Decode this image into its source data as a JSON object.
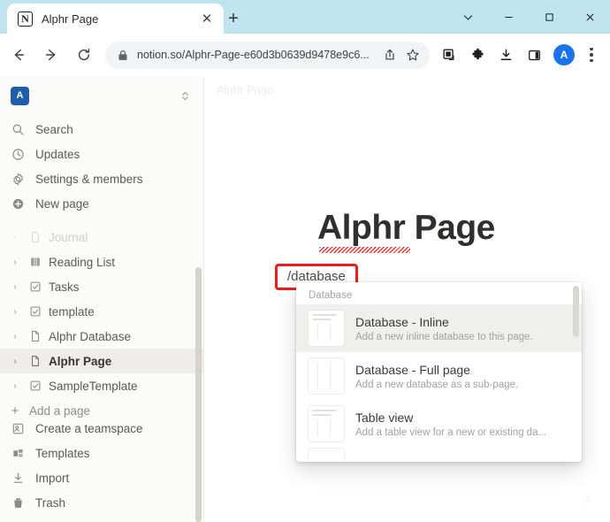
{
  "window": {
    "controls": [
      {
        "name": "tab-search-button",
        "icon": "chevron-down-icon"
      },
      {
        "name": "minimize-button",
        "icon": "minimize-icon"
      },
      {
        "name": "maximize-button",
        "icon": "maximize-icon"
      },
      {
        "name": "close-button",
        "icon": "close-icon"
      }
    ]
  },
  "tab": {
    "title": "Alphr Page",
    "favicon_letter": "N",
    "close_glyph": "✕",
    "new_tab_glyph": "+"
  },
  "toolbar": {
    "back_title": "Back",
    "forward_title": "Forward",
    "reload_title": "Reload",
    "url": "notion.so/Alphr-Page-e60d3b0639d9478e9c6...",
    "lock_icon": "lock-icon",
    "share_icon": "share-icon",
    "bookmark_icon": "star-icon",
    "capture_icon": "screen-capture-icon",
    "extensions_icon": "puzzle-icon",
    "downloads_icon": "download-icon",
    "side_panel_icon": "side-panel-icon",
    "avatar_letter": "A",
    "menu_icon": "three-dot-menu-icon"
  },
  "sidebar": {
    "workspace": {
      "badge_letter": "A",
      "switcher_icon": "chevron-up-down-icon"
    },
    "nav": [
      {
        "label": "Search",
        "icon": "search-icon"
      },
      {
        "label": "Updates",
        "icon": "clock-icon"
      },
      {
        "label": "Settings & members",
        "icon": "gear-icon"
      },
      {
        "label": "New page",
        "icon": "plus-circle-icon"
      }
    ],
    "pages_cut_off": {
      "label": "Journal",
      "icon": "page-icon"
    },
    "pages": [
      {
        "label": "Reading List",
        "icon": "books-icon",
        "caret": "›",
        "active": false
      },
      {
        "label": "Tasks",
        "icon": "checkbox-icon",
        "caret": "›",
        "active": false
      },
      {
        "label": "template",
        "icon": "checkbox-icon",
        "caret": "›",
        "active": false
      },
      {
        "label": "Alphr Database",
        "icon": "page-icon",
        "caret": "›",
        "active": false
      },
      {
        "label": "Alphr Page",
        "icon": "page-icon",
        "caret": "›",
        "active": true
      },
      {
        "label": "SampleTemplate",
        "icon": "checkbox-icon",
        "caret": "›",
        "active": false
      }
    ],
    "add_page": {
      "label": "Add a page",
      "glyph": "+"
    },
    "bottom": [
      {
        "label": "Create a teamspace",
        "icon": "teamspace-icon"
      },
      {
        "label": "Templates",
        "icon": "templates-icon"
      },
      {
        "label": "Import",
        "icon": "import-icon"
      },
      {
        "label": "Trash",
        "icon": "trash-icon"
      }
    ]
  },
  "main": {
    "breadcrumb": "Alphr Page",
    "doc_title": "Alphr Page",
    "slash_input": "/database",
    "help_glyph": "?"
  },
  "slash_menu": {
    "section_label": "Database",
    "items": [
      {
        "name": "Database - Inline",
        "description": "Add a new inline database to this page.",
        "icon": "database-inline-thumb",
        "selected": true,
        "has_header_lines": true
      },
      {
        "name": "Database - Full page",
        "description": "Add a new database as a sub-page.",
        "icon": "database-fullpage-thumb",
        "selected": false,
        "has_header_lines": false
      },
      {
        "name": "Table view",
        "description": "Add a table view for a new or existing da...",
        "icon": "table-view-thumb",
        "selected": false,
        "has_header_lines": true
      }
    ]
  },
  "colors": {
    "titlebar": "#bfe4ef",
    "accent_blue": "#1a73e8",
    "workspace_badge": "#1f5ea8",
    "highlight_red": "#ea1f1c",
    "spellcheck_red": "#ea2d28",
    "sidebar_bg": "#fbfbfa",
    "selected_row": "#efefee",
    "tag_blue": "#4b8fd4",
    "tag_orange": "#e7a33e",
    "tag_red": "#e05a4e",
    "tag_green": "#4da36a"
  }
}
